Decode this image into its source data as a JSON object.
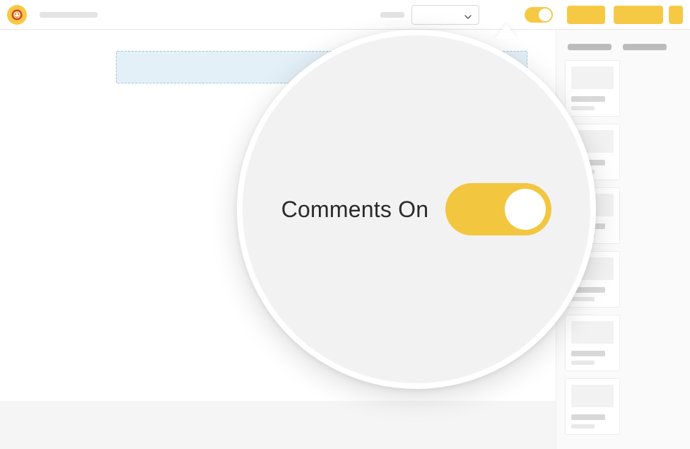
{
  "callout": {
    "toggle_label": "Comments On",
    "toggle_state": "on"
  },
  "colors": {
    "accent": "#f6c945",
    "highlight_band": "#e4f0f7"
  },
  "icons": {
    "logo": "monkey-face-icon",
    "select_chevron": "chevron-down-icon"
  }
}
